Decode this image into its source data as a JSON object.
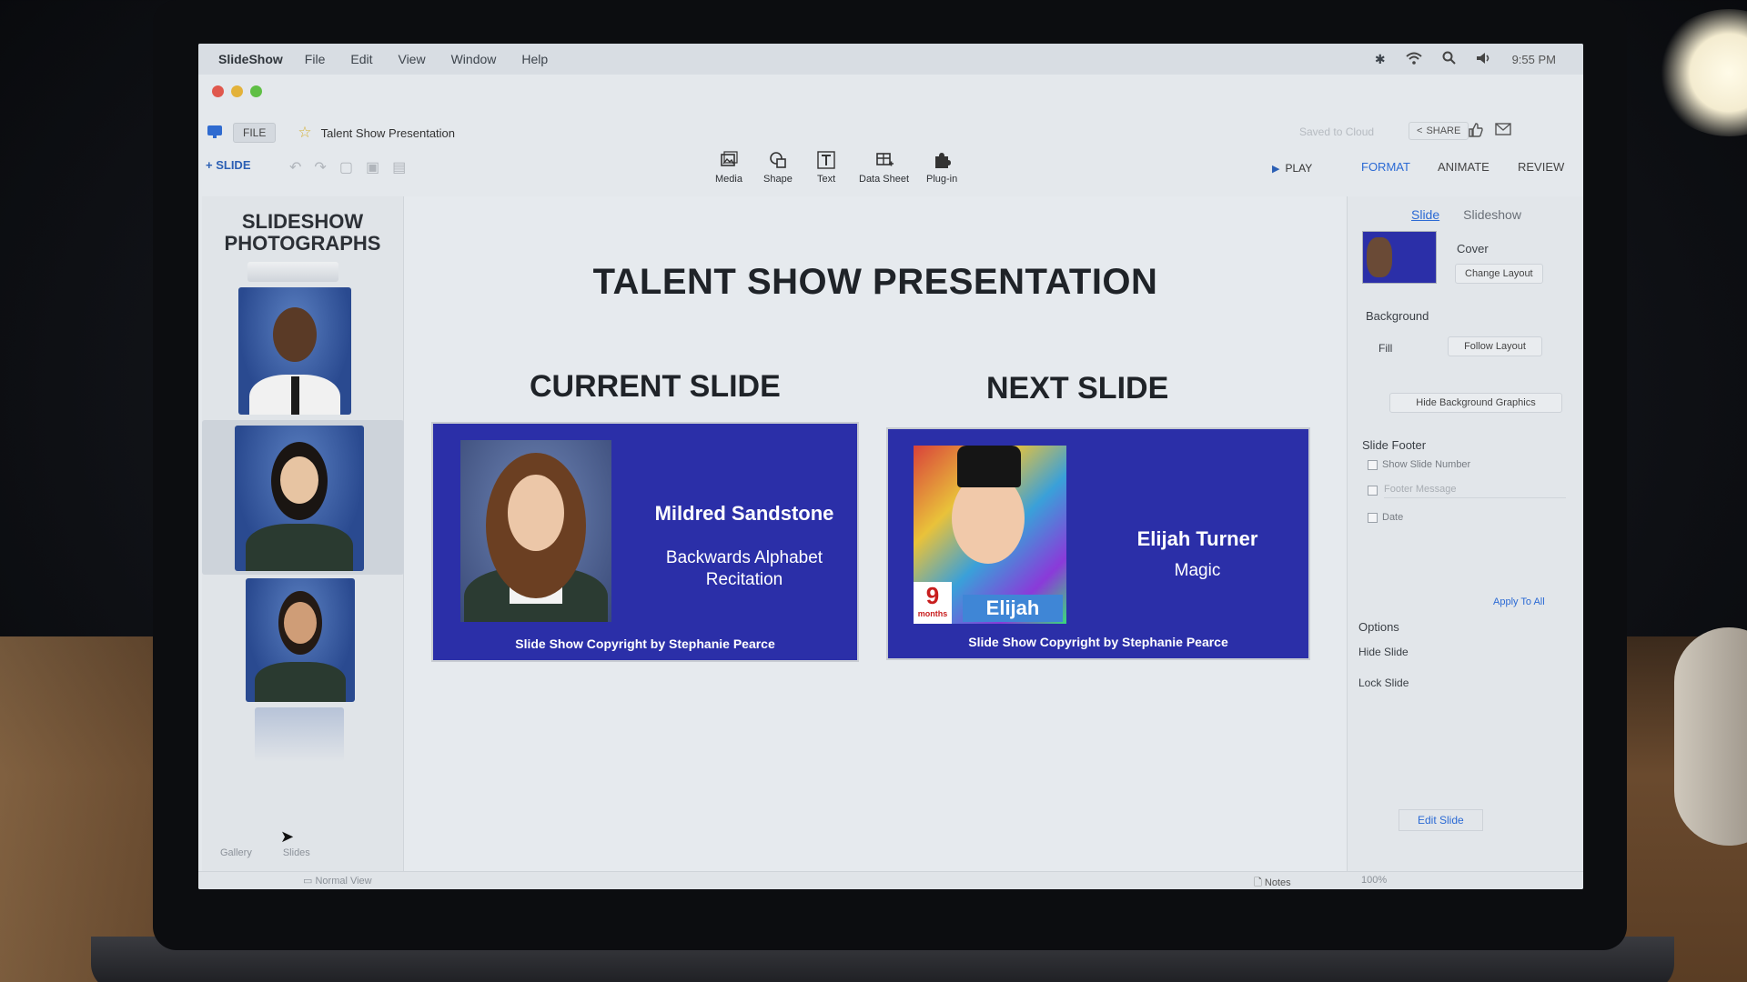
{
  "menubar": {
    "app": "SlideShow",
    "items": [
      "File",
      "Edit",
      "View",
      "Window",
      "Help"
    ],
    "clock": "9:55 PM"
  },
  "filebar": {
    "file_button": "FILE",
    "doc_title": "Talent Show Presentation",
    "saved": "Saved to Cloud",
    "share": "SHARE"
  },
  "toolbar": {
    "add_slide": "+ SLIDE",
    "tools": [
      {
        "label": "Media",
        "icon": "media-icon"
      },
      {
        "label": "Shape",
        "icon": "shape-icon"
      },
      {
        "label": "Text",
        "icon": "text-icon"
      },
      {
        "label": "Data Sheet",
        "icon": "data-sheet-icon"
      },
      {
        "label": "Plug-in",
        "icon": "plugin-icon"
      }
    ],
    "play": "PLAY",
    "right_tabs": [
      "FORMAT",
      "ANIMATE",
      "REVIEW"
    ]
  },
  "left_panel": {
    "title_line1": "SLIDESHOW",
    "title_line2": "PHOTOGRAPHS",
    "tabs": [
      "Gallery",
      "Slides"
    ]
  },
  "main": {
    "title": "TALENT SHOW PRESENTATION",
    "current_label": "CURRENT SLIDE",
    "next_label": "NEXT SLIDE",
    "current_slide": {
      "name": "Mildred Sandstone",
      "act_line1": "Backwards Alphabet",
      "act_line2": "Recitation",
      "copyright": "Slide Show Copyright by Stephanie Pearce"
    },
    "next_slide": {
      "name": "Elijah Turner",
      "act": "Magic",
      "copyright": "Slide Show Copyright by Stephanie Pearce",
      "photo_number": "9",
      "photo_small": "months",
      "photo_caption": "Elijah"
    }
  },
  "right_panel": {
    "tab_slide": "Slide",
    "tab_slideshow": "Slideshow",
    "layout_name": "Cover",
    "change_layout": "Change Layout",
    "background": "Background",
    "fill": "Fill",
    "follow_layout": "Follow Layout",
    "hide_bg": "Hide Background Graphics",
    "slide_footer": "Slide Footer",
    "show_slide_number": "Show Slide Number",
    "footer_message": "Footer Message",
    "date": "Date",
    "apply_to_all": "Apply To All",
    "options": "Options",
    "hide_slide": "Hide Slide",
    "lock_slide": "Lock Slide",
    "edit_slide": "Edit Slide"
  },
  "statusbar": {
    "view": "Normal View",
    "notes": "Notes",
    "zoom": "100%"
  },
  "colors": {
    "slide_blue": "#2b2fa8",
    "accent": "#2b6ad4"
  }
}
